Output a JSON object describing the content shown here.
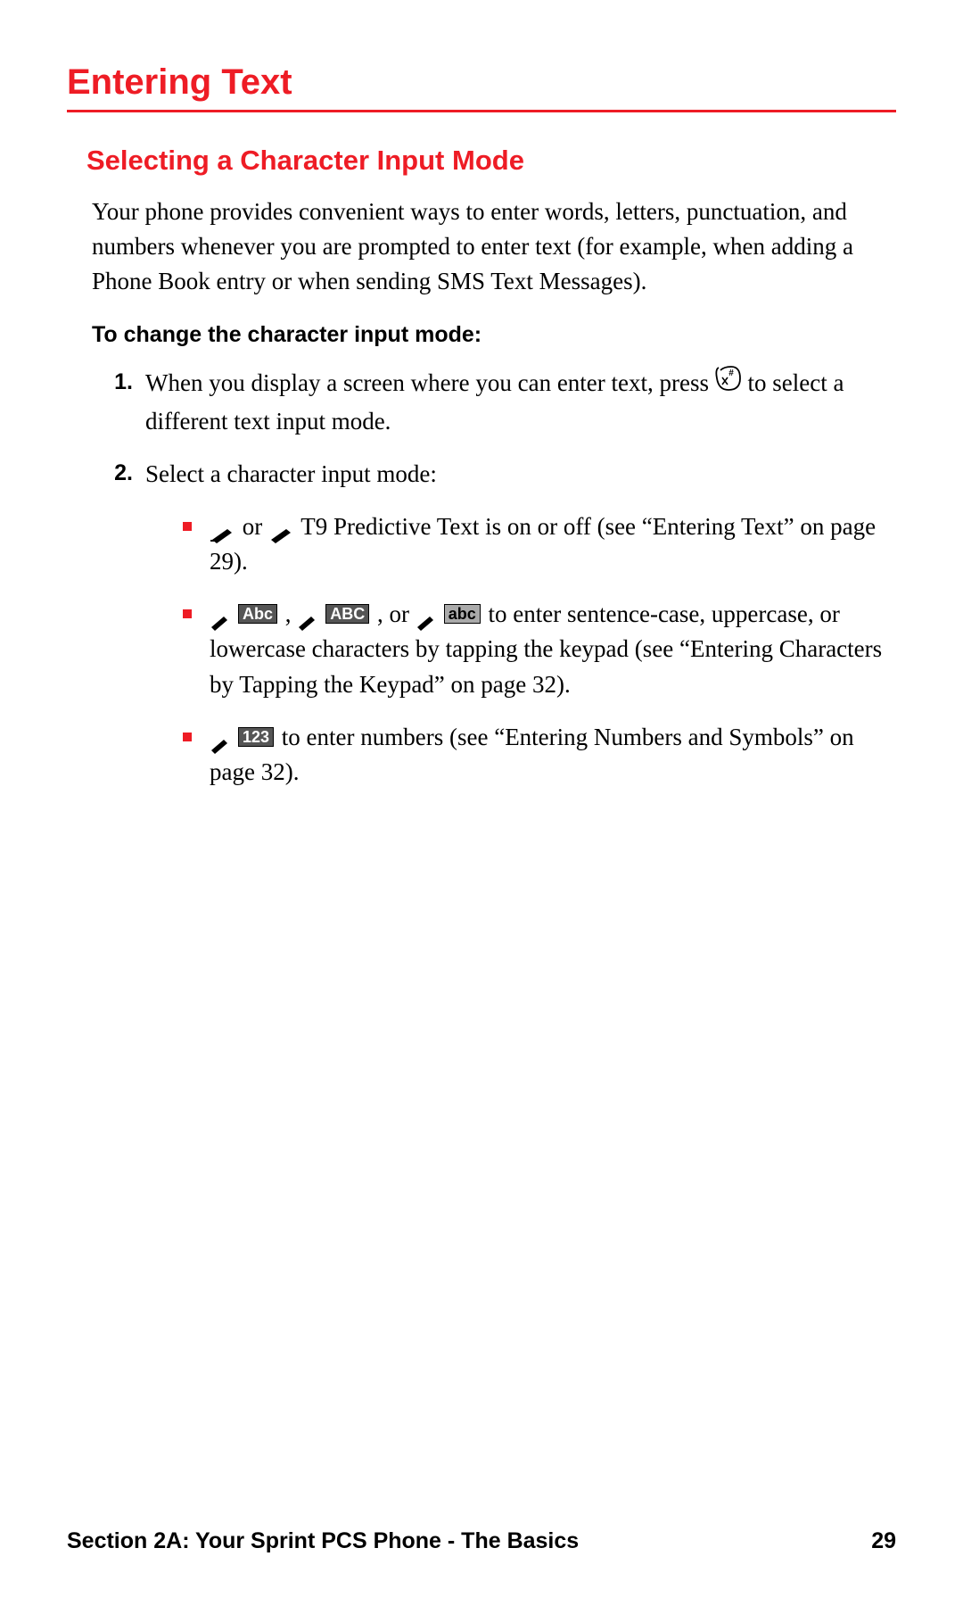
{
  "title": "Entering Text",
  "subtitle": "Selecting a Character Input Mode",
  "intro": "Your phone provides convenient ways to enter words, letters, punctuation, and numbers whenever you are prompted to enter text (for example, when adding a Phone Book entry or when sending SMS Text Messages).",
  "instruction": "To change the character input mode:",
  "step1_num": "1.",
  "step1_a": "When you display a screen where you can enter text, press ",
  "step1_b": " to select a different text input mode.",
  "step2_num": "2.",
  "step2_text": "Select a character input mode:",
  "bullet1_or": " or ",
  "bullet1_rest": " T9 Predictive Text is on or off (see “Entering Text” on page 29).",
  "bullet2_sep1": " , ",
  "bullet2_sep2": " , or ",
  "bullet2_rest": " to enter sentence-case, uppercase, or lowercase characters by tapping the keypad (see “Entering Characters by Tapping the Keypad” on page 32).",
  "bullet3_rest": " to enter numbers (see “Entering Numbers and Symbols” on page 32).",
  "labels": {
    "Abc": "Abc",
    "ABC": "ABC",
    "abc": "abc",
    "123": "123"
  },
  "footer_left": "Section 2A: Your Sprint PCS Phone - The Basics",
  "footer_right": "29"
}
